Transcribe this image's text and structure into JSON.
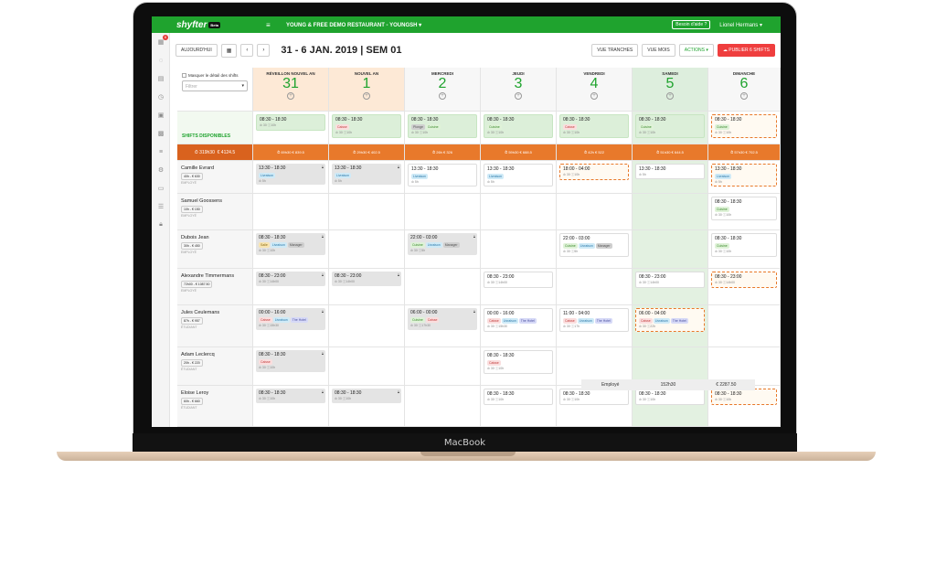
{
  "device_label": "MacBook",
  "app": {
    "logo": "shyfter",
    "logo_tag": "Beta",
    "restaurant": "YOUNG & FREE DEMO RESTAURANT - YOUNGSH",
    "help": "Besoin d'aide ?",
    "user": "Lionel Hermans"
  },
  "sidebar": {
    "badge": "6",
    "icons": [
      "calendar-icon",
      "chat-icon",
      "document-icon",
      "clock-icon",
      "clipboard-icon",
      "grid-icon",
      "sliders-icon",
      "settings-icon",
      "card-icon",
      "list-icon",
      "lock-icon"
    ]
  },
  "toolbar": {
    "today": "AUJOURD'HUI",
    "prev": "‹",
    "next": "›",
    "period": "31 - 6 JAN. 2019 | SEM 01",
    "view_slots": "VUE TRANCHES",
    "view_month": "VUE MOIS",
    "actions": "ACTIONS",
    "publish": "PUBLIER 6 SHIFTS"
  },
  "controls": {
    "hide_details": "Masquer le détail des shifts",
    "filter_placeholder": "Filtrer"
  },
  "available_label": "SHIFTS DISPONIBLES",
  "summary_left": {
    "hours": "⏱ 319h30",
    "amount": "€ 4124.5"
  },
  "days": [
    {
      "name": "RÉVEILLON NOUVEL AN",
      "num": "31",
      "summary": "⏱ 69h30   € 839.5"
    },
    {
      "name": "NOUVEL AN",
      "num": "1",
      "summary": "⏱ 29h30   € 402.5"
    },
    {
      "name": "MERCREDI",
      "num": "2",
      "summary": "⏱ 26h   € 326"
    },
    {
      "name": "JEUDI",
      "num": "3",
      "summary": "⏱ 59h30   € 688.5"
    },
    {
      "name": "VENDREDI",
      "num": "4",
      "summary": "⏱ 42h   € 522"
    },
    {
      "name": "SAMEDI",
      "num": "5",
      "summary": "⏱ 51h30   € 644.5"
    },
    {
      "name": "DIMANCHE",
      "num": "6",
      "summary": "⏱ 57h30   € 702.5"
    }
  ],
  "available": [
    {
      "time": "08:30 - 18:30",
      "tags": [],
      "meta": "⊘ 30 ⓘ10h"
    },
    {
      "time": "08:30 - 18:30",
      "tags": [
        [
          "Caisse",
          "cai"
        ]
      ],
      "meta": "⊘ 30 ⓘ10h"
    },
    {
      "time": "08:30 - 18:30",
      "tags": [
        [
          "Plonge",
          "man"
        ],
        [
          "Cuisine",
          "cui"
        ]
      ],
      "meta": "⊘ 30 ⓘ10h"
    },
    {
      "time": "08:30 - 18:30",
      "tags": [
        [
          "Cuisine",
          "cui"
        ]
      ],
      "meta": "⊘ 30 ⓘ10h"
    },
    {
      "time": "08:30 - 18:30",
      "tags": [
        [
          "Caisse",
          "cai"
        ]
      ],
      "meta": "⊘ 30 ⓘ10h"
    },
    {
      "time": "08:30 - 18:30",
      "tags": [
        [
          "Cuisine",
          "cui"
        ]
      ],
      "meta": "⊘ 30 ⓘ10h"
    },
    {
      "time": "08:30 - 18:30",
      "tags": [
        [
          "Cuisine",
          "cui"
        ]
      ],
      "meta": "⊘ 30 ⓘ10h"
    }
  ],
  "employees": [
    {
      "name": "Camille Evrard",
      "badge": "40h - € 630",
      "role": "EMPLOYÉ",
      "shifts": [
        {
          "time": "13:30 - 18:30",
          "tags": [
            [
              "Livraison",
              "liv"
            ]
          ],
          "meta": "⊘ 5h",
          "style": "gray",
          "lock": true
        },
        {
          "time": "13:30 - 18:30",
          "tags": [
            [
              "Livraison",
              "liv"
            ]
          ],
          "meta": "⊘ 5h",
          "style": "gray",
          "lock": true
        },
        {
          "time": "13:30 - 18:30",
          "tags": [
            [
              "Livraison",
              "liv"
            ]
          ],
          "meta": "⊘ 5h",
          "style": "plain"
        },
        {
          "time": "13:30 - 18:30",
          "tags": [
            [
              "Livraison",
              "liv"
            ]
          ],
          "meta": "⊘ 5h",
          "style": "plain"
        },
        {
          "time": "18:00 - 04:00",
          "tags": [],
          "meta": "⊘ 30 ⓘ10h",
          "style": "dashed"
        },
        {
          "time": "13:30 - 18:30",
          "tags": [],
          "meta": "⊘ 5h",
          "style": "plain"
        },
        {
          "time": "13:30 - 18:30",
          "tags": [
            [
              "Livraison",
              "liv"
            ]
          ],
          "meta": "⊘ 5h",
          "style": "dashed"
        }
      ]
    },
    {
      "name": "Samuel Goossens",
      "badge": "10h - € 150",
      "role": "EMPLOYÉ",
      "shifts": [
        null,
        null,
        null,
        null,
        null,
        null,
        {
          "time": "08:30 - 18:30",
          "tags": [
            [
              "Cuisine",
              "cui"
            ]
          ],
          "meta": "⊘ 30 ⓘ10h",
          "style": "plain"
        }
      ]
    },
    {
      "name": "Dubois Jean",
      "badge": "30h - € 450",
      "role": "EMPLOYÉ",
      "shifts": [
        {
          "time": "08:30 - 18:30",
          "tags": [
            [
              "Salle",
              "sal"
            ],
            [
              "Livraison",
              "liv"
            ],
            [
              "Manager",
              "man"
            ]
          ],
          "meta": "⊘ 30 ⓘ10h",
          "style": "gray",
          "lock": true
        },
        null,
        {
          "time": "22:00 - 03:00",
          "tags": [
            [
              "Cuisine",
              "cui"
            ],
            [
              "Livraison",
              "liv"
            ],
            [
              "Manager",
              "man"
            ]
          ],
          "meta": "⊘ 30 ⓘ5h",
          "style": "gray",
          "lock": true
        },
        null,
        {
          "time": "22:00 - 03:00",
          "tags": [
            [
              "Cuisine",
              "cui"
            ],
            [
              "Livraison",
              "liv"
            ],
            [
              "Manager",
              "man"
            ]
          ],
          "meta": "⊘ 30 ⓘ5h",
          "style": "plain"
        },
        null,
        {
          "time": "08:30 - 18:30",
          "tags": [
            [
              "Cuisine",
              "cui"
            ]
          ],
          "meta": "⊘ 30 ⓘ10h",
          "style": "plain"
        }
      ]
    },
    {
      "name": "Alexandre Timmermans",
      "badge": "72h00 - € 1087.50",
      "role": "EMPLOYÉ",
      "shifts": [
        {
          "time": "08:30 - 23:00",
          "tags": [],
          "meta": "⊘ 30 ⓘ14h00",
          "style": "gray",
          "lock": true
        },
        {
          "time": "08:30 - 23:00",
          "tags": [],
          "meta": "⊘ 30 ⓘ14h00",
          "style": "gray",
          "lock": true
        },
        null,
        {
          "time": "08:30 - 23:00",
          "tags": [],
          "meta": "⊘ 30 ⓘ14h00",
          "style": "plain"
        },
        null,
        {
          "time": "08:30 - 23:00",
          "tags": [],
          "meta": "⊘ 30 ⓘ14h00",
          "style": "plain"
        },
        {
          "time": "08:30 - 23:00",
          "tags": [],
          "meta": "⊘ 30 ⓘ14h00",
          "style": "dashed"
        }
      ]
    },
    {
      "name": "Jules Ceulemans",
      "badge": "87h - € 957",
      "role": "ÉTUDIANT",
      "shifts": [
        {
          "time": "00:00 - 16:00",
          "tags": [
            [
              "Caisse",
              "cai"
            ],
            [
              "Livraison",
              "liv"
            ],
            [
              "The Hotel",
              "hot"
            ]
          ],
          "meta": "⊘ 30 ⓘ15h30",
          "style": "gray",
          "lock": true
        },
        null,
        {
          "time": "06:00 - 00:00",
          "tags": [
            [
              "Cuisine",
              "cui"
            ],
            [
              "Caisse",
              "cai"
            ]
          ],
          "meta": "⊘ 30 ⓘ17h30",
          "style": "gray",
          "lock": true
        },
        {
          "time": "00:00 - 16:00",
          "tags": [
            [
              "Caisse",
              "cai"
            ],
            [
              "Livraison",
              "liv"
            ],
            [
              "The Hotel",
              "hot"
            ]
          ],
          "meta": "⊘ 30 ⓘ15h30",
          "style": "plain"
        },
        {
          "time": "11:00 - 04:00",
          "tags": [
            [
              "Caisse",
              "cai"
            ],
            [
              "Livraison",
              "liv"
            ],
            [
              "The Hotel",
              "hot"
            ]
          ],
          "meta": "⊘ 30 ⓘ17h",
          "style": "plain"
        },
        {
          "time": "06:00 - 04:00",
          "tags": [
            [
              "Caisse",
              "cai"
            ],
            [
              "Livraison",
              "liv"
            ],
            [
              "The Hotel",
              "hot"
            ]
          ],
          "meta": "⊘ 30 ⓘ22h",
          "style": "dashed"
        },
        null
      ]
    },
    {
      "name": "Adam Leclercq",
      "badge": "20h - € 220",
      "role": "ÉTUDIANT",
      "shifts": [
        {
          "time": "08:30 - 18:30",
          "tags": [
            [
              "Caisse",
              "cai"
            ]
          ],
          "meta": "⊘ 30 ⓘ10h",
          "style": "gray",
          "lock": true
        },
        null,
        null,
        {
          "time": "08:30 - 18:30",
          "tags": [
            [
              "Caisse",
              "cai"
            ]
          ],
          "meta": "⊘ 30 ⓘ10h",
          "style": "plain"
        },
        null,
        null,
        null
      ]
    },
    {
      "name": "Eloise Leroy",
      "badge": "60h - € 660",
      "role": "ÉTUDIANT",
      "shifts": [
        {
          "time": "08:30 - 18:30",
          "tags": [],
          "meta": "⊘ 30 ⓘ10h",
          "style": "gray",
          "lock": true
        },
        {
          "time": "08:30 - 18:30",
          "tags": [],
          "meta": "⊘ 30 ⓘ10h",
          "style": "gray",
          "lock": true
        },
        null,
        {
          "time": "08:30 - 18:30",
          "tags": [],
          "meta": "⊘ 30 ⓘ10h",
          "style": "plain"
        },
        {
          "time": "08:30 - 18:30",
          "tags": [],
          "meta": "⊘ 30 ⓘ10h",
          "style": "plain"
        },
        {
          "time": "08:30 - 18:30",
          "tags": [],
          "meta": "⊘ 30 ⓘ10h",
          "style": "plain"
        },
        {
          "time": "08:30 - 18:30",
          "tags": [],
          "meta": "⊘ 30 ⓘ10h",
          "style": "dashed"
        }
      ]
    }
  ],
  "footer": {
    "label": "Employé",
    "hours": "152h30",
    "amount": "€ 2287.50"
  }
}
